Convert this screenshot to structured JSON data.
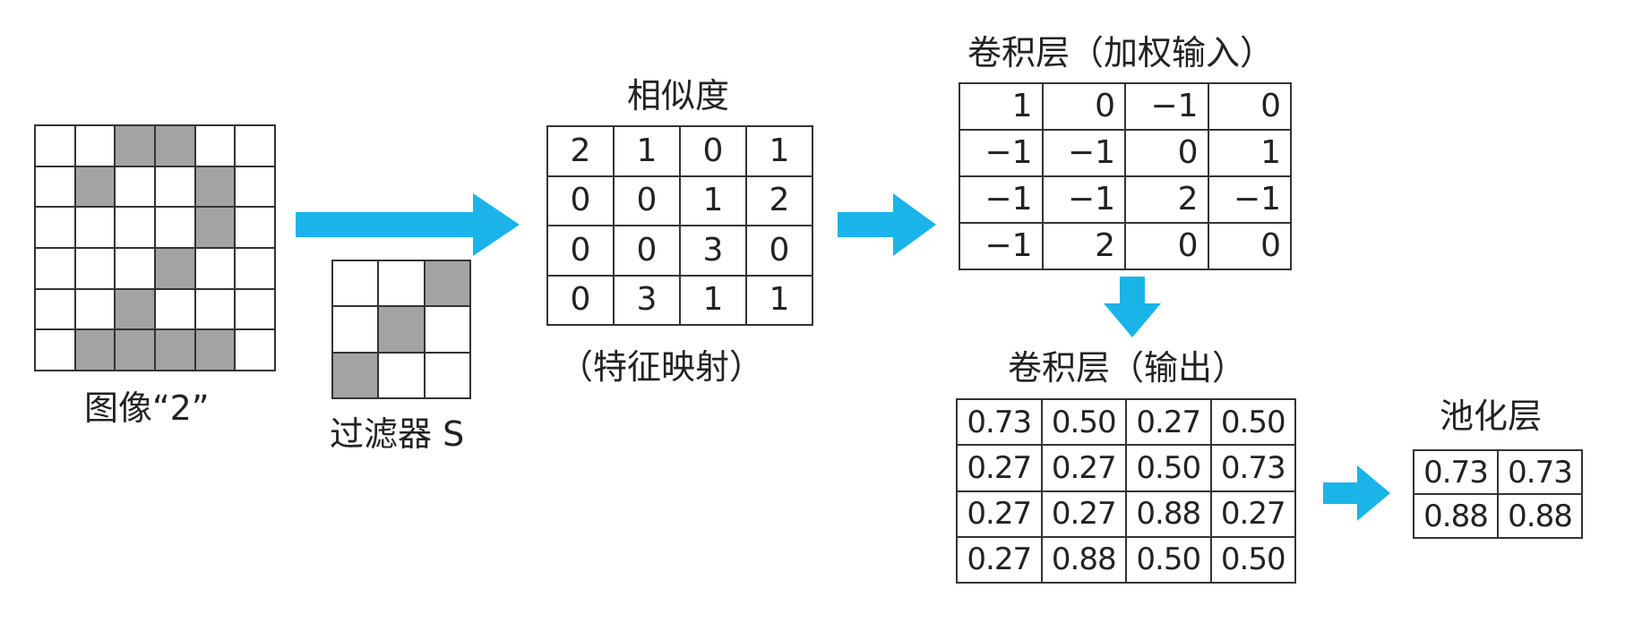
{
  "image": {
    "label": "图像“2”",
    "grid": [
      [
        0,
        0,
        1,
        1,
        0,
        0
      ],
      [
        0,
        1,
        0,
        0,
        1,
        0
      ],
      [
        0,
        0,
        0,
        0,
        1,
        0
      ],
      [
        0,
        0,
        0,
        1,
        0,
        0
      ],
      [
        0,
        0,
        1,
        0,
        0,
        0
      ],
      [
        0,
        1,
        1,
        1,
        1,
        0
      ]
    ]
  },
  "filter": {
    "label": "过滤器 S",
    "grid": [
      [
        0,
        0,
        1
      ],
      [
        0,
        1,
        0
      ],
      [
        1,
        0,
        0
      ]
    ]
  },
  "similarity": {
    "title": "相似度",
    "caption": "（特征映射）",
    "values": [
      [
        "2",
        "1",
        "0",
        "1"
      ],
      [
        "0",
        "0",
        "1",
        "2"
      ],
      [
        "0",
        "0",
        "3",
        "0"
      ],
      [
        "0",
        "3",
        "1",
        "1"
      ]
    ]
  },
  "conv_input": {
    "title": "卷积层（加权输入）",
    "values": [
      [
        "1",
        "0",
        "−1",
        "0"
      ],
      [
        "−1",
        "−1",
        "0",
        "1"
      ],
      [
        "−1",
        "−1",
        "2",
        "−1"
      ],
      [
        "−1",
        "2",
        "0",
        "0"
      ]
    ]
  },
  "conv_output": {
    "title": "卷积层（输出）",
    "values": [
      [
        "0.73",
        "0.50",
        "0.27",
        "0.50"
      ],
      [
        "0.27",
        "0.27",
        "0.50",
        "0.73"
      ],
      [
        "0.27",
        "0.27",
        "0.88",
        "0.27"
      ],
      [
        "0.27",
        "0.88",
        "0.50",
        "0.50"
      ]
    ]
  },
  "pooling": {
    "title": "池化层",
    "values": [
      [
        "0.73",
        "0.73"
      ],
      [
        "0.88",
        "0.88"
      ]
    ]
  },
  "colors": {
    "arrow": "#1ab4e8",
    "pixel_on": "#a3a3a3",
    "grid_line": "#333333"
  }
}
